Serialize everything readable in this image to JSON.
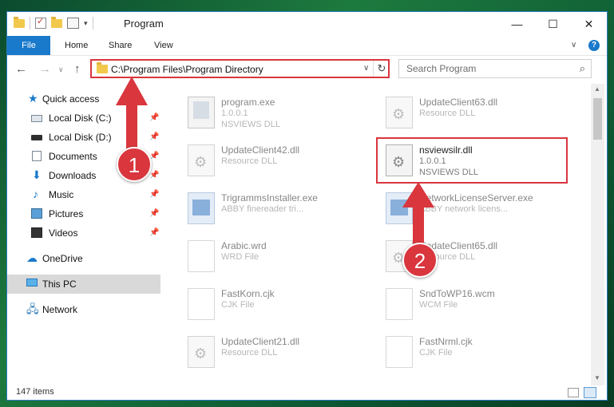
{
  "window": {
    "title": "Program",
    "minimize_glyph": "—",
    "maximize_glyph": "☐",
    "close_glyph": "✕"
  },
  "ribbon": {
    "tabs": [
      "File",
      "Home",
      "Share",
      "View"
    ],
    "help_glyph": "?"
  },
  "navigation": {
    "address": "C:\\Program Files\\Program Directory",
    "search_placeholder": "Search Program"
  },
  "sidebar": {
    "items": [
      {
        "label": "Quick access",
        "icon": "star-icon",
        "pinned": false
      },
      {
        "label": "Local Disk (C:)",
        "icon": "drive-icon",
        "pinned": true
      },
      {
        "label": "Local Disk (D:)",
        "icon": "drive-icon",
        "pinned": true
      },
      {
        "label": "Documents",
        "icon": "documents-icon",
        "pinned": true
      },
      {
        "label": "Downloads",
        "icon": "download-icon",
        "pinned": true
      },
      {
        "label": "Music",
        "icon": "music-icon",
        "pinned": true
      },
      {
        "label": "Pictures",
        "icon": "pictures-icon",
        "pinned": true
      },
      {
        "label": "Videos",
        "icon": "videos-icon",
        "pinned": true
      },
      {
        "label": "OneDrive",
        "icon": "cloud-icon",
        "pinned": false
      },
      {
        "label": "This PC",
        "icon": "computer-icon",
        "pinned": false,
        "selected": true
      },
      {
        "label": "Network",
        "icon": "network-icon",
        "pinned": false
      }
    ]
  },
  "files": [
    {
      "name": "program.exe",
      "line2": "1.0.0.1",
      "line3": "NSVIEWS DLL",
      "icon": "program-icon",
      "faded": true
    },
    {
      "name": "UpdateClient63.dll",
      "line2": "Resource DLL",
      "line3": "",
      "icon": "gear-file-icon",
      "faded": true
    },
    {
      "name": "UpdateClient42.dll",
      "line2": "Resource DLL",
      "line3": "",
      "icon": "gear-file-icon",
      "faded": true
    },
    {
      "name": "nsviewsilr.dll",
      "line2": "1.0.0.1",
      "line3": "NSVIEWS DLL",
      "icon": "gear-file-icon",
      "faded": false,
      "highlighted": true
    },
    {
      "name": "TrigrammsInstaller.exe",
      "line2": "ABBY finereader tri...",
      "line3": "",
      "icon": "exe-icon",
      "faded": true
    },
    {
      "name": "NetworkLicenseServer.exe",
      "line2": "ABBY network licens...",
      "line3": "",
      "icon": "exe-icon",
      "faded": true
    },
    {
      "name": "Arabic.wrd",
      "line2": "WRD File",
      "line3": "",
      "icon": "document-icon",
      "faded": true
    },
    {
      "name": "UpdateClient65.dll",
      "line2": "Resource DLL",
      "line3": "",
      "icon": "gear-file-icon",
      "faded": true
    },
    {
      "name": "FastKorn.cjk",
      "line2": "CJK File",
      "line3": "",
      "icon": "document-icon",
      "faded": true
    },
    {
      "name": "SndToWP16.wcm",
      "line2": "WCM File",
      "line3": "",
      "icon": "document-icon",
      "faded": true
    },
    {
      "name": "UpdateClient21.dll",
      "line2": "Resource DLL",
      "line3": "",
      "icon": "gear-file-icon",
      "faded": true
    },
    {
      "name": "FastNrml.cjk",
      "line2": "CJK File",
      "line3": "",
      "icon": "document-icon",
      "faded": true
    }
  ],
  "status": {
    "item_count": "147 items"
  },
  "annotations": {
    "step1": "1",
    "step2": "2",
    "accent_color": "#d9363e"
  }
}
